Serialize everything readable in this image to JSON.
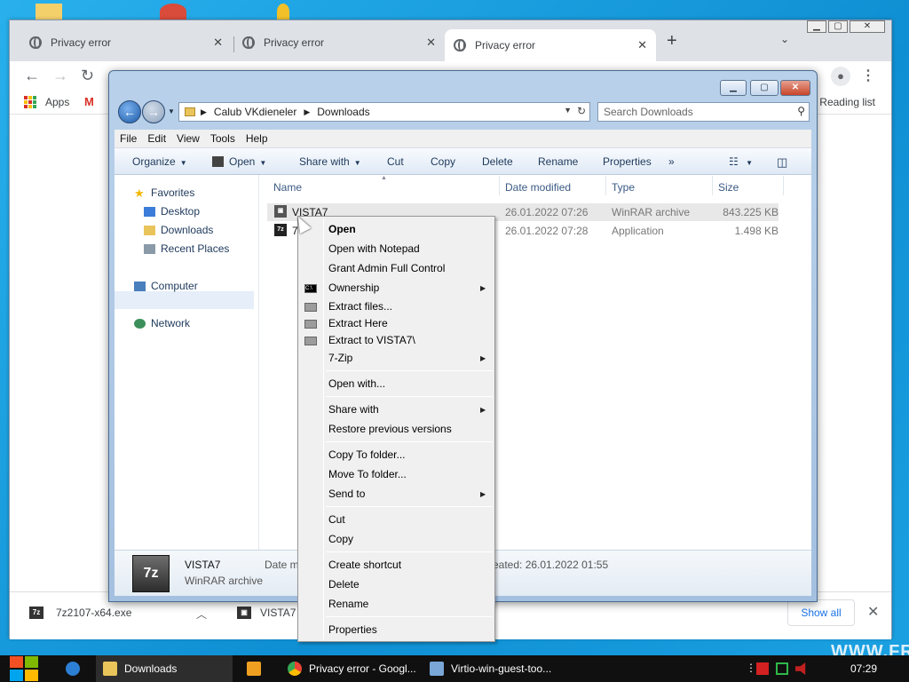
{
  "chrome": {
    "tabs": [
      {
        "title": "Privacy error",
        "close": "✕"
      },
      {
        "title": "Privacy error",
        "close": "✕"
      },
      {
        "title": "Privacy error",
        "close": "✕"
      }
    ],
    "new_tab": "+",
    "tab_search": "⌄",
    "bookmarks": {
      "apps": "Apps",
      "gmail_glyph": "M",
      "reading_list": "Reading list"
    }
  },
  "downloads_bar": {
    "items": [
      {
        "name": "7z2107-x64.exe",
        "icon_text": "7z"
      },
      {
        "name": "VISTA7",
        "icon_text": "▣"
      }
    ],
    "show_all": "Show all",
    "close": "✕"
  },
  "explorer": {
    "breadcrumb": [
      "Calub VKdieneler",
      "Downloads"
    ],
    "search_placeholder": "Search Downloads",
    "menu": [
      "File",
      "Edit",
      "View",
      "Tools",
      "Help"
    ],
    "commands": {
      "organize": "Organize",
      "open": "Open",
      "share_with": "Share with",
      "cut": "Cut",
      "copy": "Copy",
      "delete": "Delete",
      "rename": "Rename",
      "properties": "Properties",
      "more": "»"
    },
    "nav": {
      "favorites": "Favorites",
      "desktop": "Desktop",
      "downloads": "Downloads",
      "recent_places": "Recent Places",
      "computer": "Computer",
      "network": "Network"
    },
    "columns": {
      "name": "Name",
      "date_modified": "Date modified",
      "type": "Type",
      "size": "Size"
    },
    "files": [
      {
        "name": "VISTA7",
        "date": "26.01.2022 07:26",
        "type": "WinRAR archive",
        "size": "843.225 KB",
        "icon": "▣"
      },
      {
        "name": "7",
        "date": "26.01.2022 07:28",
        "type": "Application",
        "size": "1.498 KB",
        "icon": "7z"
      }
    ],
    "details": {
      "name": "VISTA7",
      "type": "WinRAR archive",
      "date_modified_label": "Date m",
      "created": "eated: 26.01.2022 01:55",
      "icon_text": "7z"
    }
  },
  "context_menu": {
    "items": {
      "open": "Open",
      "open_notepad": "Open with Notepad",
      "grant_admin": "Grant Admin Full Control",
      "ownership": "Ownership",
      "extract_files": "Extract files...",
      "extract_here": "Extract Here",
      "extract_to": "Extract to VISTA7\\",
      "seven_zip": "7-Zip",
      "open_with": "Open with...",
      "share_with": "Share with",
      "restore": "Restore previous versions",
      "copy_to": "Copy To folder...",
      "move_to": "Move To folder...",
      "send_to": "Send to",
      "cut": "Cut",
      "copy": "Copy",
      "create_shortcut": "Create shortcut",
      "delete": "Delete",
      "rename": "Rename",
      "properties": "Properties"
    }
  },
  "taskbar": {
    "items": [
      {
        "label": "Downloads"
      },
      {
        "label": ""
      },
      {
        "label": "Privacy error - Googl..."
      },
      {
        "label": "Virtio-win-guest-too..."
      }
    ],
    "clock": "07:29"
  },
  "watermark": "WWW.FR",
  "colors": {
    "accent": "#1a73e8",
    "desktop": "#1ba1e2",
    "taskbar": "#101010"
  }
}
